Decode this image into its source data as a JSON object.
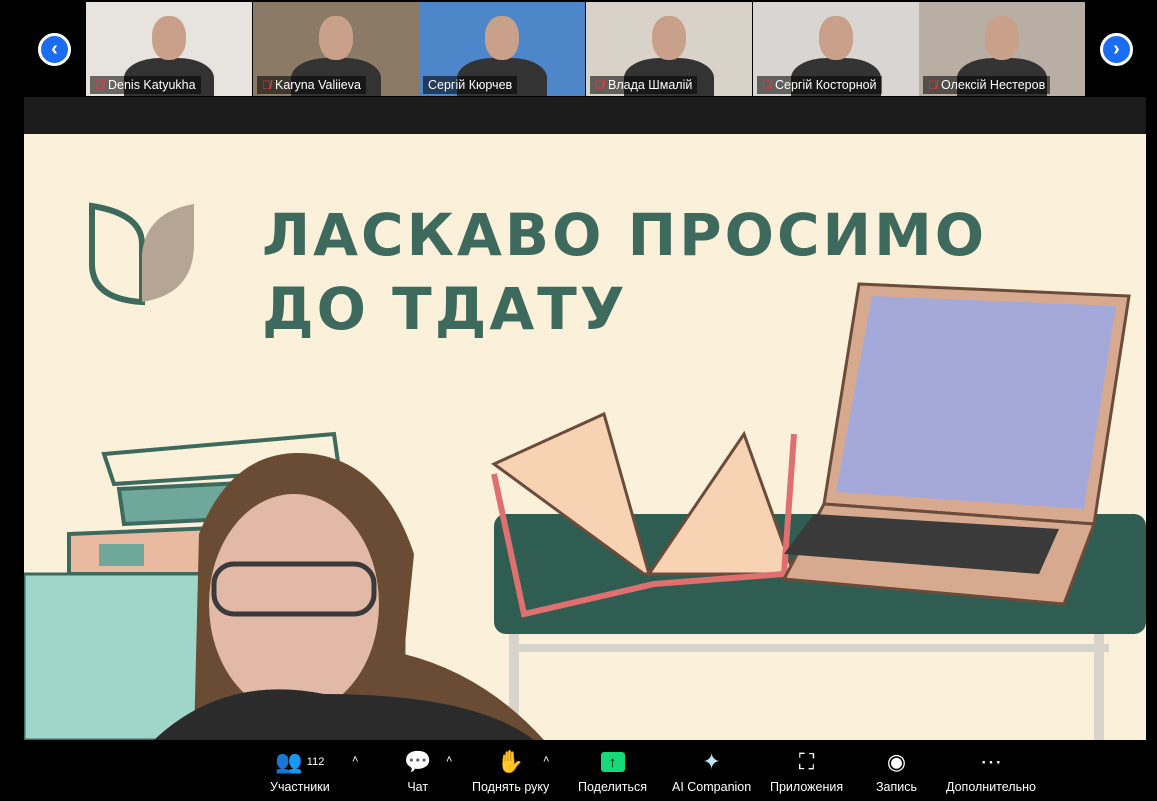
{
  "participants_strip": {
    "prev_label": "‹",
    "next_label": "›",
    "tiles": [
      {
        "name": "Denis Katyukha",
        "muted": true,
        "bg": "#e7e4df"
      },
      {
        "name": "Karyna Valiieva",
        "muted": true,
        "bg": "#8a7a66"
      },
      {
        "name": "Сергій Кюрчев",
        "muted": false,
        "bg": "#4d86c9"
      },
      {
        "name": "Влада Шмалій",
        "muted": true,
        "bg": "#d9d2c8"
      },
      {
        "name": "Сергій Косторной",
        "muted": true,
        "bg": "#d8d5d2"
      },
      {
        "name": "Олексій Нестеров",
        "muted": true,
        "bg": "#b9aea4"
      }
    ]
  },
  "slide": {
    "title_line1": "ЛАСКАВО ПРОСИМО",
    "title_line2": "ДО ТДАТУ",
    "accent": "#3d6a5d",
    "background": "#fbf0d9"
  },
  "toolbar": {
    "participants": {
      "label": "Участники",
      "count": "112"
    },
    "chat": {
      "label": "Чат"
    },
    "raise_hand": {
      "label": "Поднять руку"
    },
    "share": {
      "label": "Поделиться",
      "color": "#17d97a"
    },
    "ai": {
      "label": "AI Companion"
    },
    "apps": {
      "label": "Приложения"
    },
    "record": {
      "label": "Запись"
    },
    "more": {
      "label": "Дополнительно"
    },
    "caret": "˄"
  }
}
